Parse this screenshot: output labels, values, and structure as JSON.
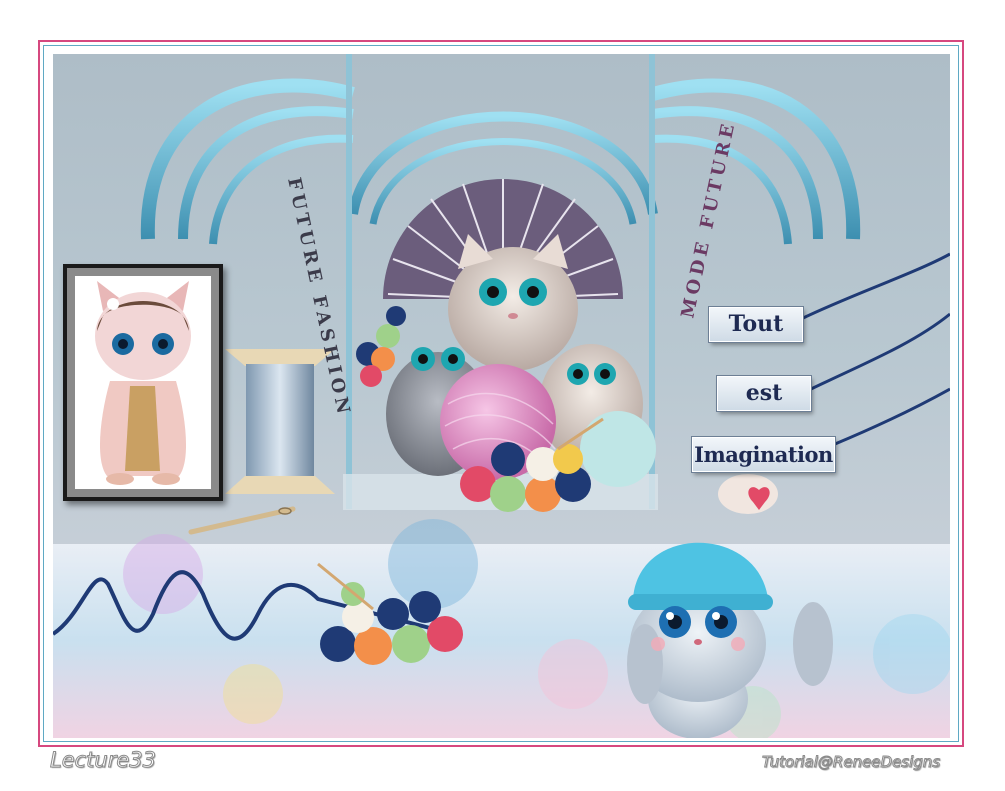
{
  "artwork": {
    "arc_text_left": "FUTURE FASHION",
    "arc_text_right": "MODE FUTURE",
    "words": [
      "Tout",
      "est",
      "Imagination"
    ]
  },
  "signatures": {
    "left": "Lecture33",
    "right": "Tutorial@ReneeDesigns"
  },
  "colors": {
    "frame_pink": "#d6487f",
    "frame_blue": "#5fa9c4",
    "word_text": "#1e2a52",
    "yarn_pink": "#e69ac9",
    "hat_blue": "#4ec3e3"
  }
}
